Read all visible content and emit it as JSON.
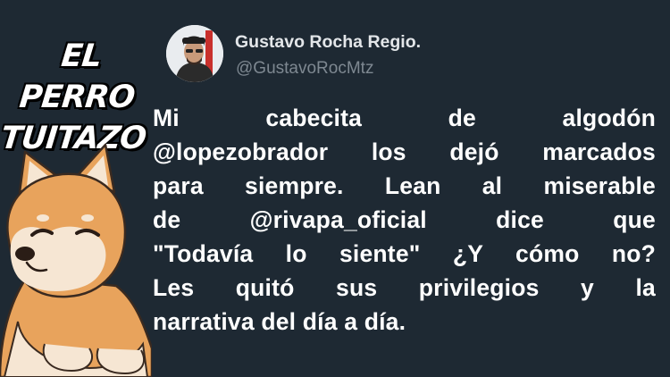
{
  "brand": {
    "line1": "EL PERRO",
    "line2": "TUITAZO"
  },
  "tweet": {
    "author_name": "Gustavo Rocha Regio.",
    "author_handle": "@GustavoRocMtz",
    "lines": [
      "Mi cabecita de algodón",
      "@lopezobrador los dejó marcados",
      "para siempre. Lean al miserable",
      "de @rivapa_oficial dice que",
      "\"Todavía lo siente\" ¿Y cómo no?",
      "Les quitó sus privilegios y la",
      "narrativa del día a día."
    ]
  },
  "colors": {
    "background": "#1e2933",
    "text": "#ffffff",
    "handle": "#7e8891",
    "dog_fur": "#e8a35c"
  },
  "icons": {
    "mascot": "shiba-inu-dog-illustration",
    "avatar": "profile-photo"
  }
}
